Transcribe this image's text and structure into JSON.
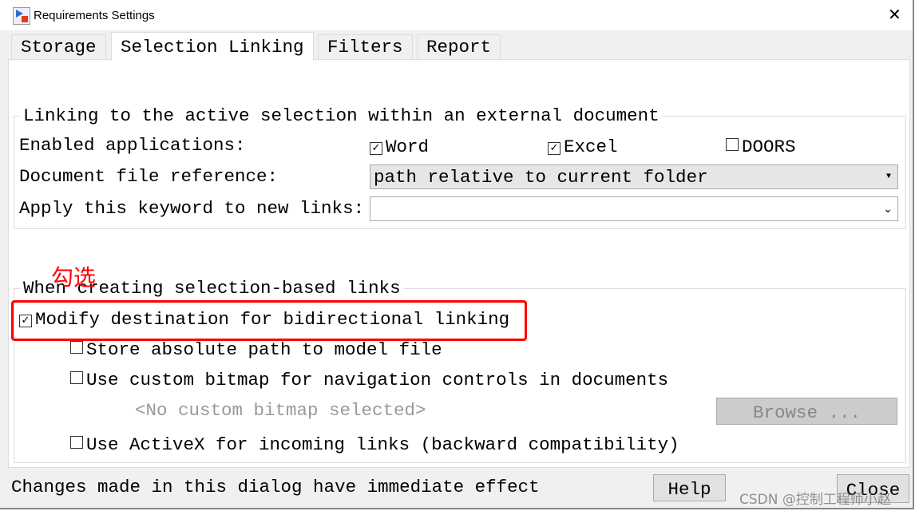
{
  "window": {
    "title": "Requirements Settings"
  },
  "tabs": [
    {
      "label": "Storage"
    },
    {
      "label": "Selection Linking",
      "active": true
    },
    {
      "label": "Filters"
    },
    {
      "label": "Report"
    }
  ],
  "group1": {
    "legend": "Linking to the active selection within an external document",
    "enabled_label": "Enabled applications:",
    "apps": [
      {
        "label": "Word",
        "checked": true
      },
      {
        "label": "Excel",
        "checked": true
      },
      {
        "label": "DOORS",
        "checked": false
      }
    ],
    "docref_label": "Document file reference:",
    "docref_value": "path relative to current folder",
    "keyword_label": "Apply this keyword to new links:",
    "keyword_value": ""
  },
  "annotation": {
    "text": "勾选",
    "color": "#ff0000"
  },
  "group2": {
    "legend": "When creating selection-based links",
    "options": [
      {
        "label": "Modify destination for bidirectional linking",
        "checked": true
      },
      {
        "label": "Store absolute path to model file",
        "checked": false
      },
      {
        "label": "Use custom bitmap for navigation controls in documents",
        "checked": false
      },
      {
        "label": "Use ActiveX for incoming links (backward compatibility)",
        "checked": false
      }
    ],
    "bitmap_placeholder": "<No custom bitmap selected>",
    "browse_label": "Browse ..."
  },
  "footer": {
    "status": "Changes made in this dialog have immediate effect",
    "help_label": "Help",
    "close_label": "Close"
  },
  "watermark": "CSDN @控制工程师小赵"
}
